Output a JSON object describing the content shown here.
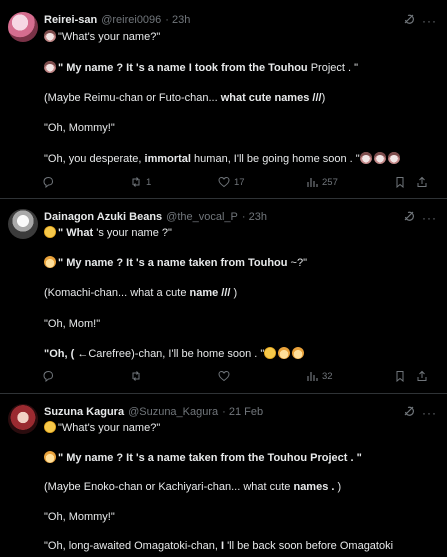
{
  "tweets": [
    {
      "author": "Reirei-san",
      "handle": "@reirei0096",
      "time": "· 23h",
      "lines": [
        {
          "parts": [
            {
              "t": "\"What's your name?\"",
              "b": false
            }
          ],
          "emoji": [
            "face"
          ]
        },
        {
          "parts": [
            {
              "t": "\" My name ? It 's a name I took from the Touhou",
              "b": true
            },
            {
              "t": " Project . \"",
              "b": false
            }
          ],
          "emoji": [
            "face"
          ]
        },
        {
          "parts": [
            {
              "t": "(Maybe Reimu-chan or Futo-chan... ",
              "b": false
            },
            {
              "t": "what cute names ///",
              "b": true
            },
            {
              "t": ")",
              "b": false
            }
          ],
          "emoji": []
        },
        {
          "parts": [
            {
              "t": "\"Oh, Mommy!\"",
              "b": false
            }
          ],
          "emoji": []
        },
        {
          "parts": [
            {
              "t": "\"Oh, you desperate, ",
              "b": false
            },
            {
              "t": "immortal",
              "b": true
            },
            {
              "t": " human, I'll be going home soon . \"",
              "b": false
            }
          ],
          "emoji": [],
          "trail": [
            "face",
            "face",
            "face"
          ]
        }
      ],
      "stats": {
        "replies": "",
        "reposts": "1",
        "likes": "17",
        "views": "257"
      }
    },
    {
      "author": "Dainagon Azuki Beans",
      "handle": "@the_vocal_P",
      "time": "· 23h",
      "lines": [
        {
          "parts": [
            {
              "t": "\" What",
              "b": true
            },
            {
              "t": " 's your name ?\"",
              "b": false
            }
          ],
          "emoji": [
            "yellow"
          ]
        },
        {
          "parts": [
            {
              "t": "\" My name ? It 's a name taken from Touhou",
              "b": true
            },
            {
              "t": " ~?\"",
              "b": false
            }
          ],
          "emoji": [
            "blond"
          ]
        },
        {
          "parts": [
            {
              "t": "(Komachi-chan... what a cute ",
              "b": false
            },
            {
              "t": "name ///",
              "b": true
            },
            {
              "t": " )",
              "b": false
            }
          ],
          "emoji": []
        },
        {
          "parts": [
            {
              "t": "\"Oh, Mom!\"",
              "b": false
            }
          ],
          "emoji": []
        },
        {
          "parts": [
            {
              "t": "\"Oh, ( ",
              "b": false
            },
            {
              "t": "←Carefree)-chan, I'll be home soon . \"",
              "b": false
            }
          ],
          "emoji": [],
          "trail": [
            "yellow",
            "blond",
            "blond"
          ]
        }
      ],
      "stats": {
        "replies": "",
        "reposts": "",
        "likes": "",
        "views": "32"
      }
    },
    {
      "author": "Suzuna Kagura",
      "handle": "@Suzuna_Kagura",
      "time": "· 21 Feb",
      "lines": [
        {
          "parts": [
            {
              "t": "\"What's your name?\"",
              "b": false
            }
          ],
          "emoji": [
            "yellow"
          ]
        },
        {
          "parts": [
            {
              "t": "\" My name ? It 's a name taken from the Touhou",
              "b": true
            },
            {
              "t": " Project . \"",
              "b": false
            }
          ],
          "emoji": [
            "blond"
          ]
        },
        {
          "parts": [
            {
              "t": "(Maybe Enoko-chan or Kachiyari-chan... what cute ",
              "b": false
            },
            {
              "t": "names .",
              "b": true
            },
            {
              "t": " )",
              "b": false
            }
          ],
          "emoji": []
        },
        {
          "parts": [
            {
              "t": "\"Oh, Mommy!\"",
              "b": false
            }
          ],
          "emoji": []
        },
        {
          "parts": [
            {
              "t": "\"Oh, long-awaited Omagatoki-chan, ",
              "b": false
            },
            {
              "t": "I",
              "b": true
            },
            {
              "t": " 'll be back soon before Omagatoki",
              "b": false
            }
          ],
          "emoji": []
        }
      ],
      "stats": null
    }
  ],
  "icons": {
    "more": "more-dots-icon",
    "grok": "grok-icon",
    "reply": "reply-icon",
    "repost": "repost-icon",
    "like": "heart-icon",
    "views": "views-icon",
    "bookmark": "bookmark-icon",
    "share": "share-icon"
  },
  "colors": {
    "background": "#000000",
    "text": "#e7e9ea",
    "muted": "#71767b",
    "divider": "#2f3336"
  }
}
